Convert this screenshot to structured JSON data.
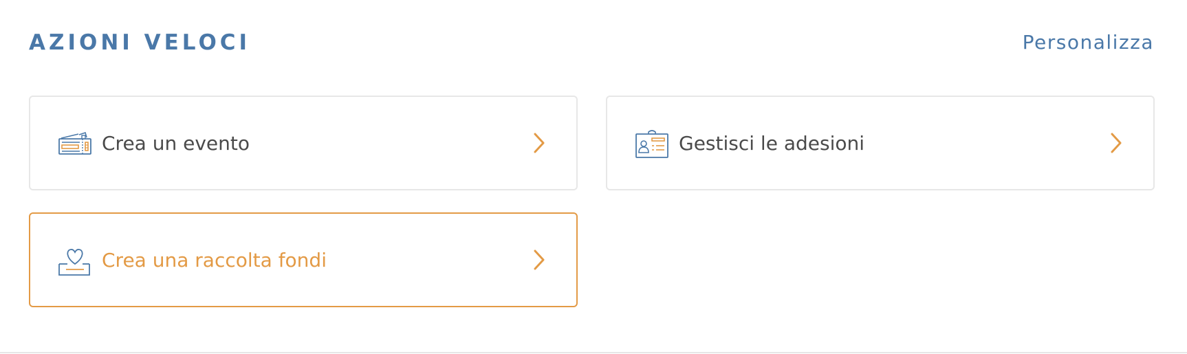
{
  "header": {
    "title": "AZIONI VELOCI",
    "customize_label": "Personalizza"
  },
  "actions": [
    {
      "label": "Crea un evento",
      "icon": "ticket-icon",
      "state": "default"
    },
    {
      "label": "Gestisci le adesioni",
      "icon": "member-card-icon",
      "state": "default"
    },
    {
      "label": "Crea una raccolta fondi",
      "icon": "donation-box-icon",
      "state": "highlighted"
    }
  ],
  "colors": {
    "title": "#4a78a8",
    "accent": "#e39a45",
    "text": "#4a4a4a",
    "border": "#e7e7e7"
  }
}
